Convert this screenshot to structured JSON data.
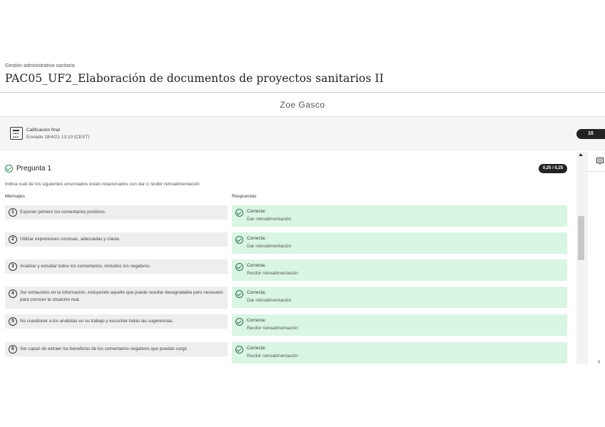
{
  "header": {
    "breadcrumb": "Gestión administrativa sanitaria",
    "title": "PAC05_UF2_Elaboración de documentos de proyectos sanitarios II",
    "student_name": "Zoe Gasco"
  },
  "grade": {
    "label": "Calificación final",
    "posted": "Enviado 18/4/21 13:10 (CEST)",
    "value": "10",
    "icon": "gradebook-icon"
  },
  "question": {
    "title": "Pregunta 1",
    "score": "0,25 / 0,25",
    "instruction": "Indica cuál de los siguientes enunciados están relacionados con dar o recibir retroalimentación",
    "col_messages": "Mensajes",
    "col_answers": "Respuestas",
    "rows": [
      {
        "num": "1",
        "message": "Exponer primero los comentarios positivos.",
        "status": "Correcta:",
        "answer": "Dar retroalimentación"
      },
      {
        "num": "2",
        "message": "Utilizar expresiones concisas, adecuadas y claras.",
        "status": "Correcta:",
        "answer": "Dar retroalimentación"
      },
      {
        "num": "3",
        "message": "Analizar y estudiar todos los comentarios, incluidos los negativos.",
        "status": "Correcta:",
        "answer": "Recibir retroalimentación"
      },
      {
        "num": "4",
        "message": "Ser exhaustivo en la información, incluyendo aquello que puede resultar desagradable pero necesario para conocer la situación real.",
        "status": "Correcta:",
        "answer": "Dar retroalimentación"
      },
      {
        "num": "5",
        "message": "No cuestionar a los analistas en su trabajo y escuchar todas las sugerencias.",
        "status": "Correcta:",
        "answer": "Recibir retroalimentación"
      },
      {
        "num": "6",
        "message": "Ser capaz de extraer los beneficios de los comentarios negativos que puedan surgir.",
        "status": "Correcta:",
        "answer": "Recibir retroalimentación"
      }
    ]
  },
  "colors": {
    "correct_bg": "#d9f5e4",
    "correct_icon": "#2f8a4f",
    "pill_bg": "#222222"
  }
}
